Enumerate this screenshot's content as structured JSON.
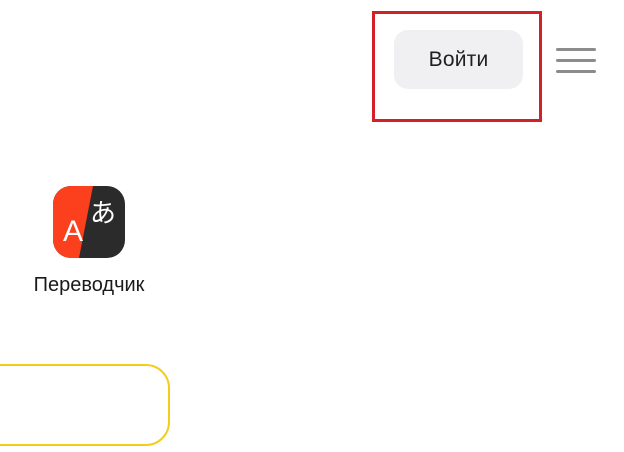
{
  "header": {
    "login_label": "Войти",
    "menu_icon": "hamburger-menu-icon",
    "highlight_color": "#d42027"
  },
  "services": [
    {
      "label": "Переводчик",
      "icon": "translate-icon",
      "icon_glyph_latin": "A",
      "icon_glyph_cjk": "あ"
    }
  ],
  "search": {
    "value": "",
    "border_color": "#f2cd1f"
  }
}
